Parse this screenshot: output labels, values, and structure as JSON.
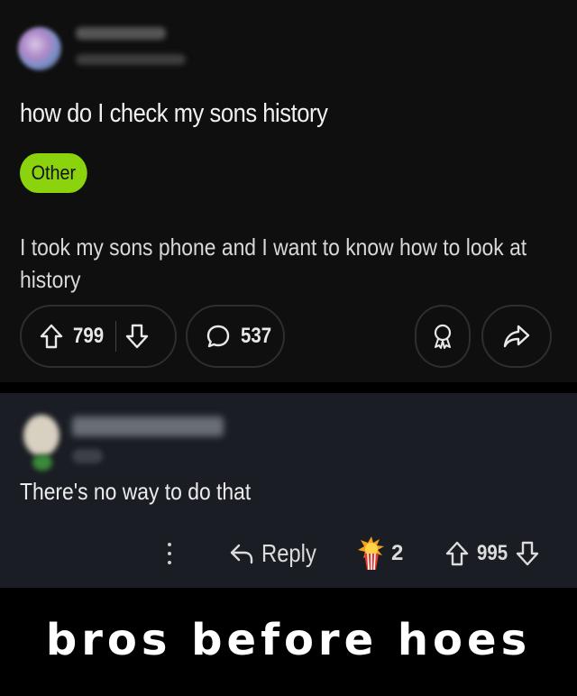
{
  "post": {
    "title": "how do I check my sons history",
    "flair": "Other",
    "body": "I took my sons phone and I want to know how to look at history",
    "upvotes": "799",
    "comments": "537",
    "icons": [
      "upvote-arrow-icon",
      "downvote-arrow-icon",
      "comment-bubble-icon",
      "award-icon",
      "share-arrow-icon"
    ]
  },
  "comment": {
    "text": "There's no way to do that",
    "reply_label": "Reply",
    "award_count": "2",
    "votes": "995",
    "icons": [
      "more-dots-icon",
      "reply-arrow-icon",
      "award-popcorn-icon",
      "upvote-arrow-icon",
      "downvote-arrow-icon"
    ]
  },
  "caption": "bros before hoes",
  "colors": {
    "flair_bg": "#8bd40d",
    "post_bg": "#0f0f0f",
    "comment_bg": "#1a1d24"
  }
}
